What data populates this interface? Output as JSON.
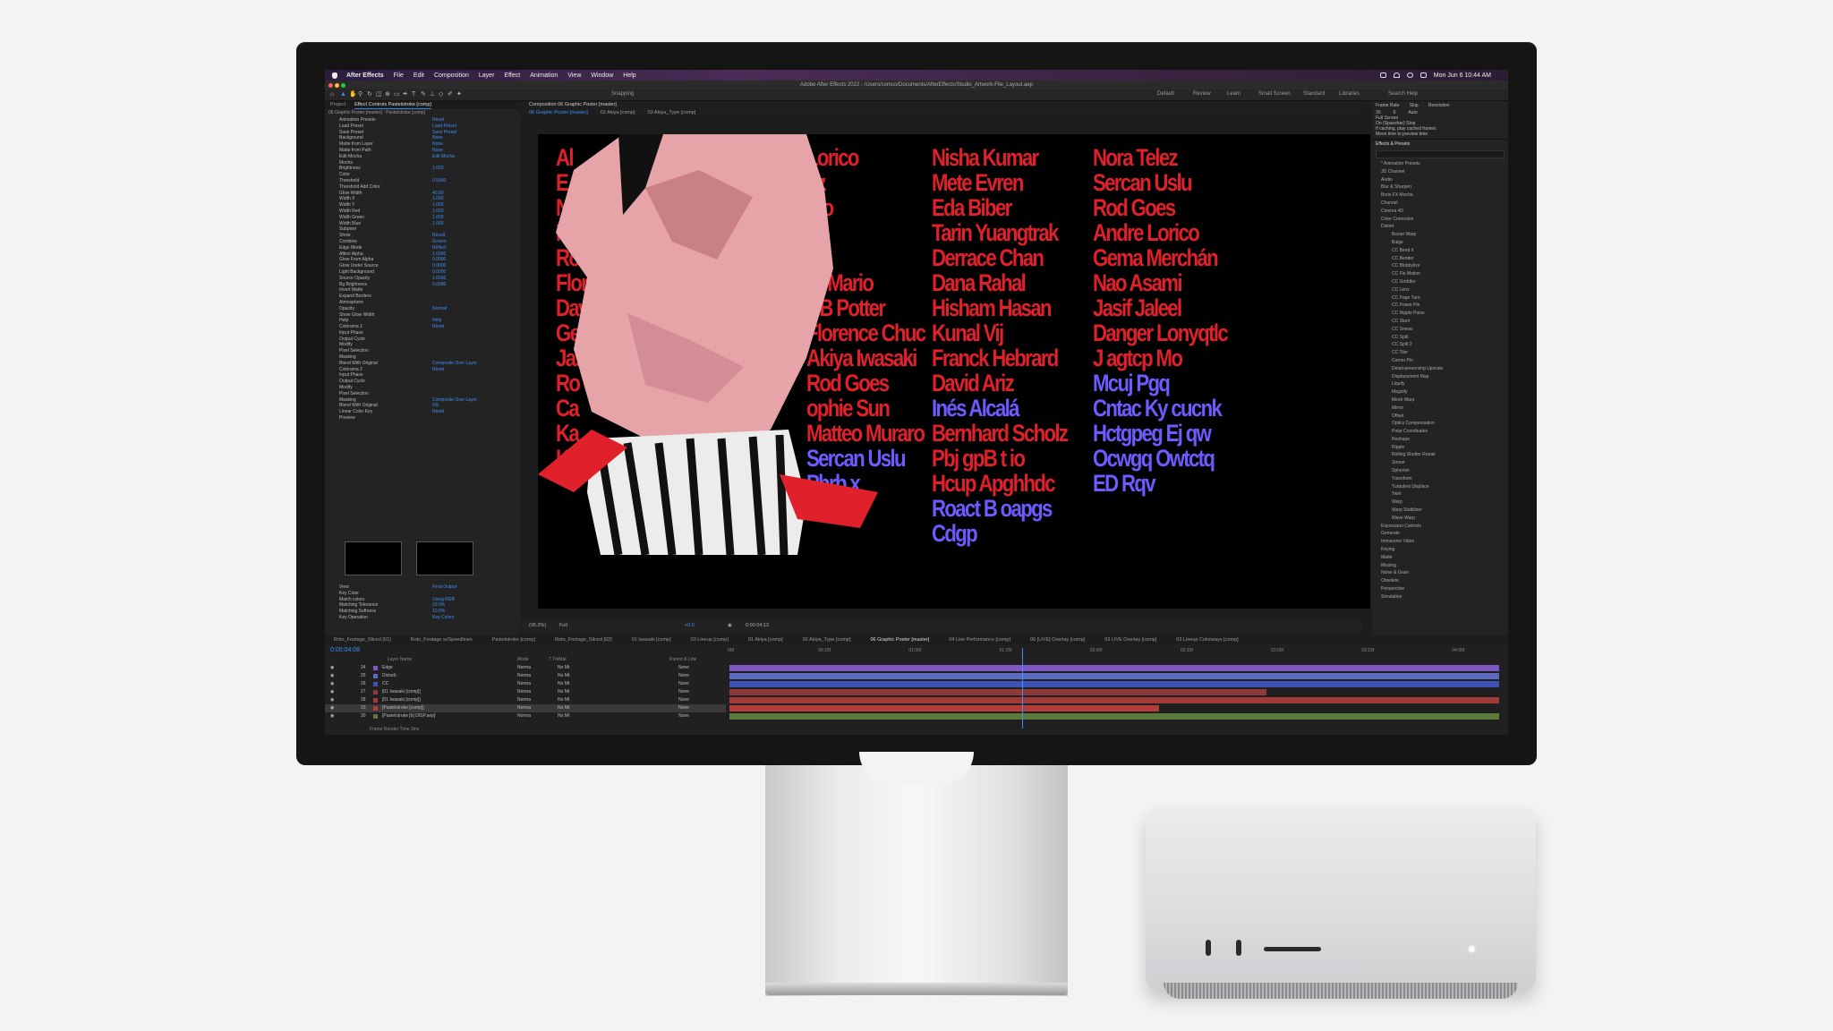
{
  "menubar": {
    "app": "After Effects",
    "menus": [
      "File",
      "Edit",
      "Composition",
      "Layer",
      "Effect",
      "Animation",
      "View",
      "Window",
      "Help"
    ],
    "clock": "Mon Jun 6  10:44 AM"
  },
  "window": {
    "title": "Adobe After Effects 2022 - /Users/comco/Documents/AfterEffects/Studio_Artwork-File_Layout.aep"
  },
  "toolbar": {
    "snapping": "Snapping",
    "workspaces": [
      "Default",
      "Review",
      "Learn",
      "Small Screen",
      "Standard",
      "Libraries"
    ],
    "search": "Search Help"
  },
  "effect_controls": {
    "tabs": [
      "Project",
      "Effect Controls Pastelstroke [comp]"
    ],
    "source": "06 Graphic Poster [master] · Pastelstroke [comp]",
    "rows": [
      {
        "label": "Animation Presets",
        "value": "Reset"
      },
      {
        "label": "Load Preset",
        "value": "Load Preset"
      },
      {
        "label": "Save Preset",
        "value": "Save Preset"
      },
      {
        "label": "Background",
        "value": "None"
      },
      {
        "label": "Matte from Layer",
        "value": "None"
      },
      {
        "label": "Matte from Path",
        "value": "None"
      },
      {
        "label": "Edit Mocha",
        "value": "Edit Mocha"
      },
      {
        "label": "Mocha",
        "value": ""
      },
      {
        "label": "Brightness",
        "value": "1.000"
      },
      {
        "label": "Color",
        "value": ""
      },
      {
        "label": "Threshold",
        "value": "0.5000"
      },
      {
        "label": "Threshold Add Color",
        "value": ""
      },
      {
        "label": "Glow Width",
        "value": "40.00"
      },
      {
        "label": "Width X",
        "value": "1.000"
      },
      {
        "label": "Width Y",
        "value": "1.000"
      },
      {
        "label": "Width Red",
        "value": "1.000"
      },
      {
        "label": "Width Green",
        "value": "1.000"
      },
      {
        "label": "Width Blue",
        "value": "1.000"
      },
      {
        "label": "Subpixel",
        "value": ""
      },
      {
        "label": "Show",
        "value": "Result"
      },
      {
        "label": "Combine",
        "value": "Screen"
      },
      {
        "label": "Edge Mode",
        "value": "Reflect"
      },
      {
        "label": "Affect Alpha",
        "value": "1.0000"
      },
      {
        "label": "Glow From Alpha",
        "value": "0.0000"
      },
      {
        "label": "Glow Under Source",
        "value": "0.0000"
      },
      {
        "label": "Light Background",
        "value": "0.0000"
      },
      {
        "label": "Source Opacity",
        "value": "1.0000"
      },
      {
        "label": "Bg Brightness",
        "value": "0.0000"
      },
      {
        "label": "Invert Matte",
        "value": ""
      },
      {
        "label": "Expand Borders",
        "value": ""
      },
      {
        "label": "Atmosphere",
        "value": ""
      },
      {
        "label": "Opacity",
        "value": "Normal"
      },
      {
        "label": "Show Glow Width",
        "value": ""
      },
      {
        "label": "Help",
        "value": "Help"
      },
      {
        "label": "Colorama 1",
        "value": "Reset"
      },
      {
        "label": "Input Phase",
        "value": ""
      },
      {
        "label": "Output Cycle",
        "value": ""
      },
      {
        "label": "Modify",
        "value": ""
      },
      {
        "label": "Pixel Selection",
        "value": ""
      },
      {
        "label": "Masking",
        "value": ""
      },
      {
        "label": "Blend With Original",
        "value": "Composite Over Layer"
      },
      {
        "label": "Colorama 2",
        "value": "Reset"
      },
      {
        "label": "Input Phase",
        "value": ""
      },
      {
        "label": "Output Cycle",
        "value": ""
      },
      {
        "label": "Modify",
        "value": ""
      },
      {
        "label": "Pixel Selection",
        "value": ""
      },
      {
        "label": "Masking",
        "value": "Composite Over Layer"
      },
      {
        "label": "Blend With Original",
        "value": "0%"
      },
      {
        "label": "Linear Color Key",
        "value": "Reset"
      },
      {
        "label": "Preview",
        "value": ""
      }
    ],
    "bottom_rows": [
      {
        "label": "View",
        "value": "Final Output"
      },
      {
        "label": "Key Color",
        "value": ""
      },
      {
        "label": "Match colors",
        "value": "Using RGB"
      },
      {
        "label": "Matching Tolerance",
        "value": "10.0%"
      },
      {
        "label": "Matching Softness",
        "value": "10.0%"
      },
      {
        "label": "Key Operation",
        "value": "Key Colors"
      }
    ]
  },
  "composition": {
    "panel_tab": "Composition 06 Graphic Poster [master]",
    "breadcrumbs": [
      "06 Graphic Poster [master]",
      "02 Akiya [comp]",
      "03 Akiya_Type [comp]"
    ],
    "footer": {
      "zoom": "(95.2%)",
      "quality": "Full",
      "timecode": "0:00:04:13",
      "exposure": "+0.0"
    },
    "names_col_left": [
      "Al",
      "E",
      "Ni",
      "No",
      "Ro",
      "Flore",
      "David A",
      "Gem",
      "Jasi",
      "Ro",
      "Ca",
      "Ka",
      "Ke"
    ],
    "names_col_mid": [
      "Lorico",
      "riz",
      "ero",
      "",
      "",
      "nr Mario",
      "CB Potter",
      "Florence Chuc",
      "Akiya Iwasaki",
      "Rod Goes",
      "ophie Sun",
      "Matteo Muraro",
      "Sercan Uslu",
      "Phrb x",
      "mc Zb"
    ],
    "names_col_3": [
      "Nisha Kumar",
      "Mete Evren",
      "Eda Biber",
      "Tarin Yuangtrak",
      "Derrace Chan",
      "Dana Rahal",
      "Hisham Hasan",
      "Kunal Vij",
      "Franck Hebrard",
      "David Ariz",
      "Inés Alcalá",
      "Bernhard Scholz",
      "Pbj gpB t io",
      "Hcup Apghhdc",
      "Roact B oapgs",
      "Cdgp"
    ],
    "names_col_4": [
      "Nora Telez",
      "Sercan Uslu",
      "Rod Goes",
      "Andre Lorico",
      "Gema Merchán",
      "Nao Asami",
      "Jasif Jaleel",
      "Danger Lonyqtlc",
      "J agtcp Mo",
      "Mcuj Pgq",
      "Cntac Ky cucnk",
      "Hctgpeg Ej qw",
      "Ocwgq Owtctq",
      "ED Rqv"
    ],
    "colors": {
      "red": "#e0202a",
      "blue": "#6c5cff",
      "shirt": "#e6a4a8"
    }
  },
  "effects_panel": {
    "preview": {
      "frame_rate_label": "Frame Rate",
      "skip_label": "Skip",
      "resolution_label": "Resolution",
      "frame_rate": "30",
      "skip": "0",
      "resolution": "Auto",
      "full_screen": "Full Screen",
      "on_spacebar": "On (Spacebar) Stop",
      "cache": "If caching, play cached frames",
      "move_time": "Move time to preview time"
    },
    "title": "Effects & Presets",
    "categories": [
      "* Animation Presets",
      "3D Channel",
      "Audio",
      "Blur & Sharpen",
      "Boris FX Mocha",
      "Channel",
      "Cinema 4D",
      "Color Correction",
      "Distort"
    ],
    "distort_items": [
      "Bezier Warp",
      "Bulge",
      "CC Bend It",
      "CC Bender",
      "CC Blobbylize",
      "CC Flo Motion",
      "CC Griddler",
      "CC Lens",
      "CC Page Turn",
      "CC Power Pin",
      "CC Ripple Pulse",
      "CC Slant",
      "CC Smear",
      "CC Split",
      "CC Split 2",
      "CC Tiler",
      "Corner Pin",
      "Detail-preserving Upscale",
      "Displacement Map",
      "Liquify",
      "Magnify",
      "Mesh Warp",
      "Mirror",
      "Offset",
      "Optics Compensation",
      "Polar Coordinates",
      "Reshape",
      "Ripple",
      "Rolling Shutter Repair",
      "Smear",
      "Spherize",
      "Transform",
      "Turbulent Displace",
      "Twirl",
      "Warp",
      "Warp Stabilizer",
      "Wave Warp"
    ],
    "more_categories": [
      "Expression Controls",
      "Generate",
      "Immersive Video",
      "Keying",
      "Matte",
      "Missing",
      "Noise & Grain",
      "Obsolete",
      "Perspective",
      "Simulation"
    ]
  },
  "timeline": {
    "tabs": [
      "Roto_Footage_Sliced [01]",
      "Roto_Footage w/Speedlines",
      "Pastelstroke [comp]",
      "Roto_Footage_Sliced [02]",
      "01 Iwasaki [comp]",
      "03 Lineup [comp]",
      "01 Akiya [comp]",
      "02 Akiya_Type [comp]",
      "06 Graphic Poster [master]",
      "04 Live Performance [comp]",
      "06 [LIVE] Overlay [comp]",
      "03 LIVE Overlay [comp]",
      "03 Lineup Colorways [comp]"
    ],
    "timecode": "0:00:04:08",
    "column_headers": [
      "Layer Name",
      "Mode",
      "T TrkMat",
      "Parent & Link"
    ],
    "ruler": [
      "00f",
      "00:15f",
      "01:00f",
      "01:15f",
      "02:00f",
      "02:15f",
      "03:00f",
      "03:15f",
      "04:00f"
    ],
    "layers": [
      {
        "num": "24",
        "name": "Edge",
        "mode": "Norma",
        "trk": "No Mt",
        "parent": "None",
        "color": "#7e57c2"
      },
      {
        "num": "25",
        "name": "Disturb",
        "mode": "Norma",
        "trk": "No Mt",
        "parent": "None",
        "color": "#5c6bc0"
      },
      {
        "num": "26",
        "name": "CC",
        "mode": "Norma",
        "trk": "No Mt",
        "parent": "None",
        "color": "#3f51b5"
      },
      {
        "num": "27",
        "name": "[01 Iwasaki [comp]]",
        "mode": "Norma",
        "trk": "No Mt",
        "parent": "None",
        "color": "#8e3a3a"
      },
      {
        "num": "28",
        "name": "[01 Iwasaki [comp]]",
        "mode": "Norma",
        "trk": "No Mt",
        "parent": "None",
        "color": "#a33a3a"
      },
      {
        "num": "29",
        "name": "[Pastelstroke [comp]]",
        "mode": "Norma",
        "trk": "No Mt",
        "parent": "None",
        "color": "#b63b3b"
      },
      {
        "num": "30",
        "name": "[Pastelstroke [b] DISP.aep]",
        "mode": "Norma",
        "trk": "No Mt",
        "parent": "None",
        "color": "#5a7b3a"
      }
    ],
    "footer": "Frame Render Time  3ms"
  }
}
